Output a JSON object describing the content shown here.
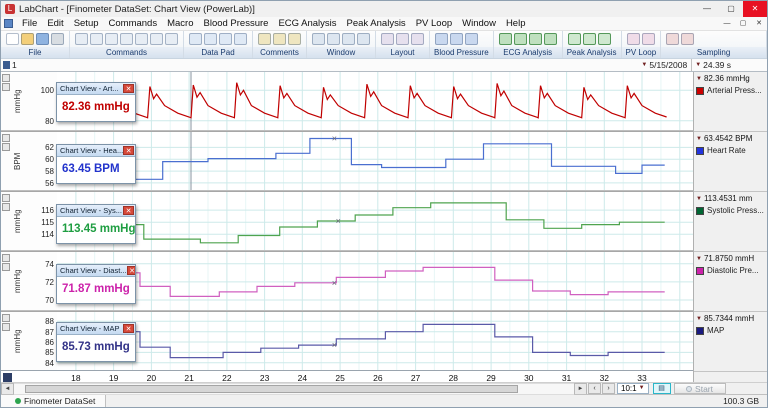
{
  "window": {
    "title": "LabChart - [Finometer DataSet: Chart View (PowerLab)]",
    "minimize": "—",
    "maximize": "▢",
    "close": "✕"
  },
  "menu": {
    "items": [
      "File",
      "Edit",
      "Setup",
      "Commands",
      "Macro",
      "Blood Pressure",
      "ECG Analysis",
      "Peak Analysis",
      "PV Loop",
      "Window",
      "Help"
    ]
  },
  "toolbar": {
    "groups": [
      {
        "label": "File",
        "icons": [
          "new-file",
          "open-file",
          "save",
          "print"
        ]
      },
      {
        "label": "Commands",
        "icons": [
          "add-to-datapad",
          "scissors",
          "copy",
          "paste",
          "zoom",
          "undo",
          "redo"
        ]
      },
      {
        "label": "Data Pad",
        "icons": [
          "datapad-view",
          "datapad-add",
          "datapad-table",
          "datapad-export"
        ]
      },
      {
        "label": "Comments",
        "icons": [
          "comment-add",
          "comment-list",
          "comment-find"
        ]
      },
      {
        "label": "Window",
        "icons": [
          "window-tile",
          "window-cascade",
          "window-zoom",
          "window-split"
        ]
      },
      {
        "label": "Layout",
        "icons": [
          "layout-single",
          "layout-stacked",
          "layout-overlay"
        ]
      },
      {
        "label": "Blood Pressure",
        "icons": [
          "bp-settings",
          "bp-view",
          "bp-report"
        ]
      },
      {
        "label": "ECG Analysis",
        "icons": [
          "ecg-settings",
          "ecg-averaging",
          "ecg-table",
          "ecg-report"
        ]
      },
      {
        "label": "Peak Analysis",
        "icons": [
          "peak-settings",
          "peak-view",
          "peak-table"
        ]
      },
      {
        "label": "PV Loop",
        "icons": [
          "pvloop-settings",
          "pvloop-view"
        ]
      },
      {
        "label": "Sampling",
        "icons": [
          "sampling-settings",
          "sampling-start"
        ]
      }
    ]
  },
  "inforow": {
    "block_label": "1",
    "date": "5/15/2008",
    "duration": "24.39 s"
  },
  "time_axis": {
    "min": 17.5,
    "max": 34.35,
    "ticks": [
      18,
      19,
      20,
      21,
      22,
      23,
      24,
      25,
      26,
      27,
      28,
      29,
      30,
      31,
      32,
      33
    ]
  },
  "cursor": {
    "t": 21.05,
    "panels": [
      0,
      1
    ]
  },
  "channels": [
    {
      "name": "Arterial Press...",
      "unit": "mmHg",
      "value_label": "82.36 mmHg",
      "color": "#c00000",
      "swatch": "#cc0000",
      "value_color": "#c00000",
      "popup": {
        "title": "Chart View - Art...",
        "value": "82.36 mmHg"
      },
      "ymin": 74,
      "ymax": 112,
      "yticks": [
        100,
        80
      ],
      "type": "beats",
      "base": 82,
      "beats": [
        {
          "t": 17.6,
          "p": 103
        },
        {
          "t": 18.75,
          "p": 104
        },
        {
          "t": 19.9,
          "p": 102.5
        },
        {
          "t": 21.05,
          "p": 103.5
        },
        {
          "t": 22.2,
          "p": 105
        },
        {
          "t": 23.35,
          "p": 103
        },
        {
          "t": 24.5,
          "p": 102
        },
        {
          "t": 25.65,
          "p": 104
        },
        {
          "t": 26.8,
          "p": 103
        },
        {
          "t": 27.95,
          "p": 102.5
        },
        {
          "t": 29.1,
          "p": 104.5
        },
        {
          "t": 30.25,
          "p": 103
        },
        {
          "t": 31.4,
          "p": 102
        },
        {
          "t": 32.55,
          "p": 103
        }
      ]
    },
    {
      "name": "Heart Rate",
      "unit": "BPM",
      "value_label": "63.4542 BPM",
      "color": "#4a6fd0",
      "swatch": "#2233dd",
      "value_color": "#2233cc",
      "popup": {
        "title": "Chart View - Hea...",
        "value": "63.45 BPM"
      },
      "ymin": 54.8,
      "ymax": 64.6,
      "yticks": [
        62,
        60,
        58,
        56
      ],
      "type": "steps",
      "marker": {
        "t": 24.85,
        "v": 63.5
      },
      "points": [
        [
          17.55,
          62.2
        ],
        [
          19.35,
          62.2
        ],
        [
          19.35,
          56.6
        ],
        [
          20.3,
          56.6
        ],
        [
          20.3,
          59.6
        ],
        [
          21.5,
          59.6
        ],
        [
          21.5,
          60.1
        ],
        [
          23.3,
          60.1
        ],
        [
          23.3,
          61.0
        ],
        [
          24.2,
          61.0
        ],
        [
          24.2,
          63.5
        ],
        [
          25.3,
          63.5
        ],
        [
          25.3,
          59.1
        ],
        [
          26.1,
          59.1
        ],
        [
          26.1,
          58.6
        ],
        [
          27.8,
          58.6
        ],
        [
          27.8,
          60.0
        ],
        [
          28.8,
          60.0
        ],
        [
          28.8,
          62.6
        ],
        [
          30.6,
          62.6
        ],
        [
          30.6,
          58.8
        ],
        [
          32.3,
          58.8
        ],
        [
          32.3,
          57.6
        ],
        [
          33.0,
          57.6
        ],
        [
          33.0,
          59.0
        ],
        [
          33.6,
          59.0
        ]
      ]
    },
    {
      "name": "Systolic Press...",
      "unit": "mmHg",
      "value_label": "113.4531 mm",
      "color": "#4fa44f",
      "swatch": "#006633",
      "value_color": "#1f9e42",
      "popup": {
        "title": "Chart View - Sys...",
        "value": "113.45 mmHg"
      },
      "ymin": 112.7,
      "ymax": 117.5,
      "yticks": [
        116,
        115,
        114
      ],
      "type": "steps",
      "marker": {
        "t": 24.95,
        "v": 115.1
      },
      "points": [
        [
          17.55,
          115.6
        ],
        [
          18.8,
          115.6
        ],
        [
          18.8,
          114.8
        ],
        [
          19.8,
          114.8
        ],
        [
          19.8,
          113.6
        ],
        [
          21.3,
          113.6
        ],
        [
          21.3,
          113.3
        ],
        [
          22.3,
          113.3
        ],
        [
          22.3,
          113.9
        ],
        [
          23.4,
          113.9
        ],
        [
          23.4,
          114.6
        ],
        [
          24.4,
          114.6
        ],
        [
          24.4,
          115.1
        ],
        [
          25.4,
          115.1
        ],
        [
          25.4,
          115.6
        ],
        [
          26.4,
          115.6
        ],
        [
          26.4,
          116.2
        ],
        [
          27.4,
          116.2
        ],
        [
          27.4,
          116.6
        ],
        [
          29.4,
          116.6
        ],
        [
          29.4,
          115.2
        ],
        [
          30.4,
          115.2
        ],
        [
          30.4,
          114.5
        ],
        [
          31.4,
          114.5
        ],
        [
          31.4,
          114.8
        ],
        [
          32.4,
          114.8
        ],
        [
          32.4,
          115.0
        ],
        [
          33.6,
          115.0
        ]
      ]
    },
    {
      "name": "Diastolic Pre...",
      "unit": "mmHg",
      "value_label": "71.8750 mmH",
      "color": "#d060c0",
      "swatch": "#cc22aa",
      "value_color": "#cc22aa",
      "popup": {
        "title": "Chart View - Diast...",
        "value": "71.87 mmHg"
      },
      "ymin": 68.9,
      "ymax": 75.3,
      "yticks": [
        74,
        72,
        70
      ],
      "type": "steps",
      "marker": {
        "t": 24.85,
        "v": 71.9
      },
      "points": [
        [
          17.55,
          73.6
        ],
        [
          18.9,
          73.6
        ],
        [
          18.9,
          73.0
        ],
        [
          19.7,
          73.0
        ],
        [
          19.7,
          71.5
        ],
        [
          20.5,
          71.5
        ],
        [
          20.5,
          70.4
        ],
        [
          21.8,
          70.4
        ],
        [
          21.8,
          70.9
        ],
        [
          22.8,
          70.9
        ],
        [
          22.8,
          71.5
        ],
        [
          23.8,
          71.5
        ],
        [
          23.8,
          71.9
        ],
        [
          24.9,
          71.9
        ],
        [
          24.9,
          72.5
        ],
        [
          26.2,
          72.5
        ],
        [
          26.2,
          73.2
        ],
        [
          27.2,
          73.2
        ],
        [
          27.2,
          73.6
        ],
        [
          29.1,
          73.6
        ],
        [
          29.1,
          72.2
        ],
        [
          30.1,
          72.2
        ],
        [
          30.1,
          71.0
        ],
        [
          31.1,
          71.0
        ],
        [
          31.1,
          70.6
        ],
        [
          32.1,
          70.6
        ],
        [
          32.1,
          70.9
        ],
        [
          33.6,
          70.9
        ]
      ]
    },
    {
      "name": "MAP",
      "unit": "mmHg",
      "value_label": "85.7344 mmH",
      "color": "#5a5aa8",
      "swatch": "#1a1a80",
      "value_color": "#333388",
      "popup": {
        "title": "Chart View - MAP",
        "value": "85.73 mmHg"
      },
      "ymin": 83.3,
      "ymax": 88.9,
      "yticks": [
        88,
        87,
        86,
        85,
        84
      ],
      "type": "steps",
      "marker": {
        "t": 24.85,
        "v": 85.7
      },
      "points": [
        [
          17.55,
          87.6
        ],
        [
          18.9,
          87.6
        ],
        [
          18.9,
          87.0
        ],
        [
          19.7,
          87.0
        ],
        [
          19.7,
          85.5
        ],
        [
          20.5,
          85.5
        ],
        [
          20.5,
          84.5
        ],
        [
          21.9,
          84.5
        ],
        [
          21.9,
          85.0
        ],
        [
          22.9,
          85.0
        ],
        [
          22.9,
          85.4
        ],
        [
          23.9,
          85.4
        ],
        [
          23.9,
          85.7
        ],
        [
          24.9,
          85.7
        ],
        [
          24.9,
          86.3
        ],
        [
          26.2,
          86.3
        ],
        [
          26.2,
          87.0
        ],
        [
          27.2,
          87.0
        ],
        [
          27.2,
          87.7
        ],
        [
          29.1,
          87.7
        ],
        [
          29.1,
          86.5
        ],
        [
          30.1,
          86.5
        ],
        [
          30.1,
          85.0
        ],
        [
          31.1,
          85.0
        ],
        [
          31.1,
          84.7
        ],
        [
          32.1,
          84.7
        ],
        [
          32.1,
          85.0
        ],
        [
          33.6,
          85.0
        ]
      ]
    }
  ],
  "bottom": {
    "zoom_ratio": "10:1",
    "start_label": "Start"
  },
  "statusbar": {
    "document": "Finometer DataSet",
    "storage": "100.3 GB"
  }
}
